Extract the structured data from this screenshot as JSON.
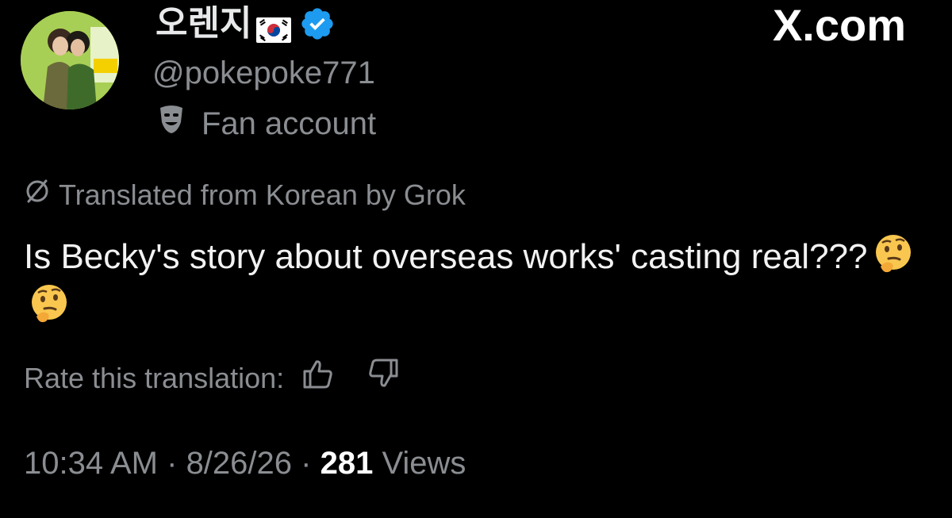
{
  "author": {
    "display_name": "오렌지",
    "flag_icon": "south-korea-flag-icon",
    "verified_icon": "verified-badge-icon",
    "handle": "@pokepoke771",
    "label_icon": "theater-mask-icon",
    "label": "Fan account"
  },
  "brand": "X.com",
  "translation": {
    "icon": "translate-icon",
    "note": "Translated from Korean by Grok",
    "rate_label": "Rate this translation:",
    "thumbs_up_icon": "thumbs-up-icon",
    "thumbs_down_icon": "thumbs-down-icon"
  },
  "tweet": {
    "text": "Is Becky's story about overseas works' casting real???",
    "emoji_icon": "thinking-face-emoji"
  },
  "meta": {
    "time": "10:34 AM",
    "sep1": " · ",
    "date": "8/26/26",
    "sep2": " · ",
    "views_count": "281",
    "views_label": " Views"
  },
  "colors": {
    "background": "#000000",
    "muted": "#8a8d91",
    "verified": "#1d9bf0"
  }
}
